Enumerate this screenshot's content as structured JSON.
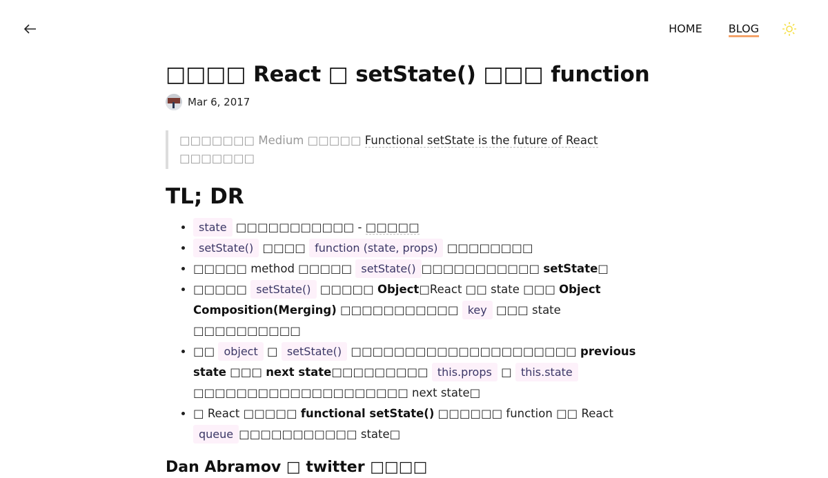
{
  "header": {
    "back_label": "Back",
    "nav": [
      {
        "label": "HOME",
        "active": false
      },
      {
        "label": "BLOG",
        "active": true
      }
    ],
    "theme_icon": "sun-icon",
    "accent_color": "#f4a36a",
    "sun_color": "#f5e04a"
  },
  "article": {
    "title": "□□□□ React □ setState() □□□ function",
    "date": "Mar 6, 2017",
    "quote": {
      "prefix": "□□□□□□□ Medium □□□□□ ",
      "link_text": "Functional setState is the future of React",
      "suffix": " □□□□□□□"
    },
    "section_title": "TL; DR",
    "bullets": {
      "b1": {
        "code1": "state",
        "text1": " □□□□□□□□□□□ - ",
        "dashed": "□□□□□"
      },
      "b2": {
        "code1": "setState()",
        "text1": " □□□□ ",
        "code2": "function (state, props)",
        "text2": " □□□□□□□□"
      },
      "b3": {
        "text1": "□□□□□ method □□□□□ ",
        "code1": "setState()",
        "text2": "□□□□□□□□□□□ ",
        "bold1": "setState",
        "text3": "□"
      },
      "b4": {
        "text1": "□□□□□ ",
        "code1": "setState()",
        "text2": " □□□□□ ",
        "bold1": "Object",
        "text3": "□React □□ state □□□ ",
        "bold2": "Object Composition(Merging)",
        "text4": " □□□□□□□□□□□ ",
        "code2": "key",
        "text5": " □□□ state □□□□□□□□□□"
      },
      "b5": {
        "text1": "□□ ",
        "code1": "object",
        "text2": " □ ",
        "code2": "setState()",
        "text3": " □□□□□□□□□□□□□□□□□□□□□ ",
        "bold1": "previous state",
        "text4": " □□□ ",
        "bold2": "next state",
        "text5": "□□□□□□□□□ ",
        "code3": "this.props",
        "text6": " □ ",
        "code4": "this.state",
        "text7": " □□□□□□□□□□□□□□□□□□□□ next state□"
      },
      "b6": {
        "text1": "□ React □□□□□ ",
        "bold1": "functional setState()",
        "text2": " □□□□□□ function □□ React ",
        "code1": "queue",
        "text3": "□□□□□□□□□□□ state□"
      }
    },
    "next_heading": "Dan Abramov □ twitter □□□□"
  }
}
